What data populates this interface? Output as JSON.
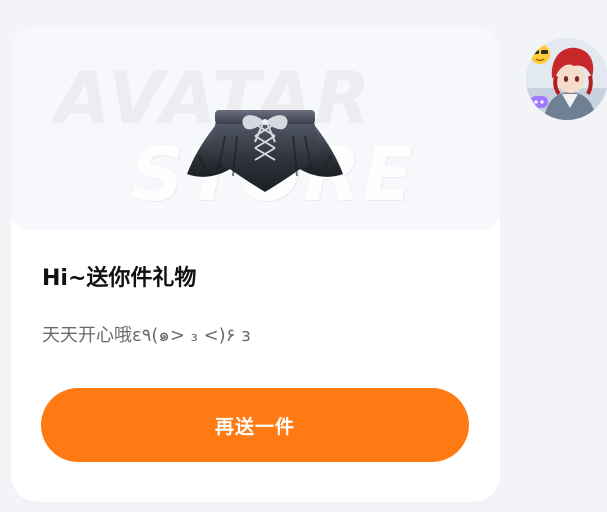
{
  "gift_card": {
    "watermark_line1": "AVATAR",
    "watermark_line2": "STORE",
    "item_image_icon": "skirt-icon",
    "title": "Hi~送你件礼物",
    "message": "天天开心哦ε٩(๑> ₃ <)۶ з",
    "send_again_label": "再送一件"
  },
  "sender": {
    "avatar_icon": "avatar-image",
    "badge_icon": "sunglasses-emoji-icon"
  },
  "colors": {
    "page_background": "#f3f4f7",
    "card_background": "#ffffff",
    "button_color": "#ff7a12",
    "button_text": "#ffffff",
    "title_text": "#111111",
    "message_text": "#6b6b6b"
  }
}
